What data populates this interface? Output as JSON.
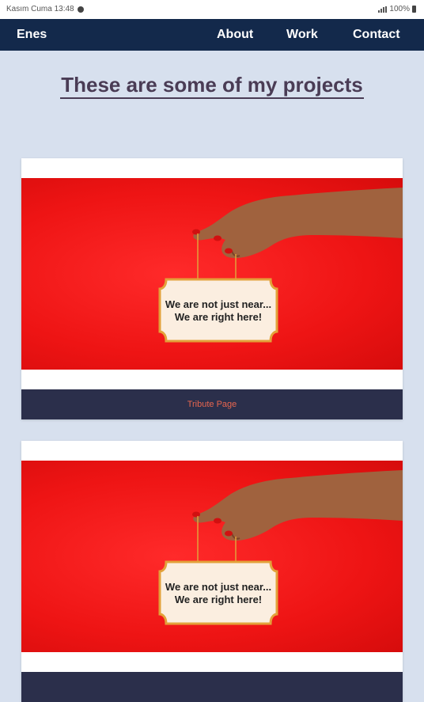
{
  "status": {
    "time": "Kasım Cuma 13:48",
    "battery": "100%"
  },
  "navbar": {
    "brand": "Enes",
    "links": [
      "About",
      "Work",
      "Contact"
    ]
  },
  "main": {
    "title": "These are some of my projects",
    "projects": [
      {
        "image_text_line1": "We are not just near...",
        "image_text_line2": "We are right here!",
        "caption": "Tribute Page"
      },
      {
        "image_text_line1": "We are not just near...",
        "image_text_line2": "We are right here!",
        "caption": ""
      }
    ]
  },
  "colors": {
    "nav_bg": "#13294b",
    "page_bg": "#d7e0ee",
    "caption_bg": "#2b2f4b",
    "caption_text": "#e8664f",
    "title": "#4a3c55"
  }
}
